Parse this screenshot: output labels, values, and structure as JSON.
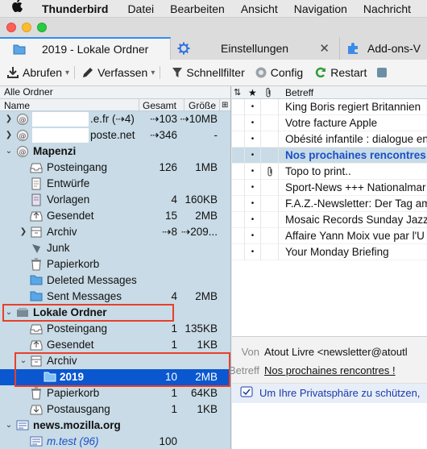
{
  "menubar": {
    "app": "Thunderbird",
    "items": [
      "Datei",
      "Bearbeiten",
      "Ansicht",
      "Navigation",
      "Nachricht"
    ]
  },
  "tabs": [
    {
      "label": "2019 - Lokale Ordner"
    },
    {
      "label": "Einstellungen"
    },
    {
      "label": "Add-ons-V"
    }
  ],
  "toolbar": {
    "fetch": "Abrufen",
    "compose": "Verfassen",
    "quickfilter": "Schnellfilter",
    "config": "Config",
    "restart": "Restart"
  },
  "folder_pane": {
    "title": "Alle Ordner",
    "col_name": "Name",
    "col_total": "Gesamt",
    "col_size": "Größe",
    "rows": [
      {
        "name": ".e.fr (⇢4)",
        "total": "⇢103",
        "size": "⇢10MB"
      },
      {
        "name": "poste.net",
        "total": "⇢346",
        "size": "-"
      },
      {
        "name": "Mapenzi",
        "total": "",
        "size": ""
      },
      {
        "name": "Posteingang",
        "total": "126",
        "size": "1MB"
      },
      {
        "name": "Entwürfe",
        "total": "",
        "size": ""
      },
      {
        "name": "Vorlagen",
        "total": "4",
        "size": "160KB"
      },
      {
        "name": "Gesendet",
        "total": "15",
        "size": "2MB"
      },
      {
        "name": "Archiv",
        "total": "⇢8",
        "size": "⇢209..."
      },
      {
        "name": "Junk",
        "total": "",
        "size": ""
      },
      {
        "name": "Papierkorb",
        "total": "",
        "size": ""
      },
      {
        "name": "Deleted Messages",
        "total": "",
        "size": ""
      },
      {
        "name": "Sent Messages",
        "total": "4",
        "size": "2MB"
      },
      {
        "name": "Lokale Ordner",
        "total": "",
        "size": ""
      },
      {
        "name": "Posteingang",
        "total": "1",
        "size": "135KB"
      },
      {
        "name": "Gesendet",
        "total": "1",
        "size": "1KB"
      },
      {
        "name": "Archiv",
        "total": "",
        "size": ""
      },
      {
        "name": "2019",
        "total": "10",
        "size": "2MB"
      },
      {
        "name": "Papierkorb",
        "total": "1",
        "size": "64KB"
      },
      {
        "name": "Postausgang",
        "total": "1",
        "size": "1KB"
      },
      {
        "name": "news.mozilla.org",
        "total": "",
        "size": ""
      },
      {
        "name": "m.test (96)",
        "total": "100",
        "size": ""
      }
    ]
  },
  "message_list": {
    "col_subject": "Betreff",
    "rows": [
      {
        "subject": "King Boris regiert Britannien"
      },
      {
        "subject": "Votre facture Apple"
      },
      {
        "subject": "Obésité infantile : dialogue en"
      },
      {
        "subject": "Nos prochaines rencontres !"
      },
      {
        "subject": "Topo to print.."
      },
      {
        "subject": "Sport-News +++ Nationalmar"
      },
      {
        "subject": "F.A.Z.-Newsletter: Der Tag am"
      },
      {
        "subject": "Mosaic Records Sunday Jazz Q"
      },
      {
        "subject": "Affaire Yann Moix vue par l'U"
      },
      {
        "subject": "Your Monday Briefing"
      }
    ]
  },
  "preview": {
    "from_label": "Von",
    "from_value": "Atout Livre <newsletter@atoutl",
    "subject_label": "Betreff",
    "subject_value": "Nos prochaines rencontres !",
    "privacy_text": "Um Ihre Privatsphäre zu schützen,"
  },
  "colors": {
    "accent": "#2f8ef0",
    "folder_pane_bg": "#c8dbe6",
    "selection": "#0a57d0",
    "unread": "#1a50c8",
    "highlight_box": "#e8402a"
  }
}
